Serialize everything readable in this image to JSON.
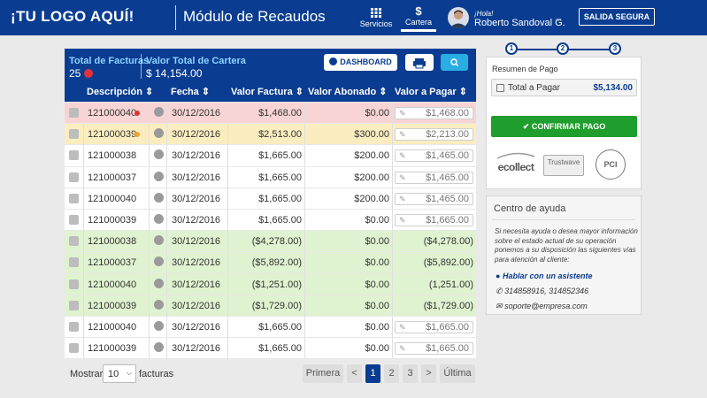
{
  "header": {
    "logo": "¡TU LOGO AQUÍ!",
    "module": "Módulo de Recaudos",
    "nav": [
      {
        "label": "Servicios",
        "icon": "grid-icon"
      },
      {
        "label": "Cartera",
        "icon": "dollar-icon"
      }
    ],
    "greeting": "¡Hola!",
    "user": "Roberto Sandoval G.",
    "logout": "SALIDA SEGURA"
  },
  "summary": {
    "facturas_label": "Total de Facturas",
    "facturas_value": "25",
    "cartera_label": "Valor Total de Cartera",
    "cartera_value": "$ 14,154.00",
    "dashboard_label": "DASHBOARD"
  },
  "columns": [
    "Descripción",
    "Fecha",
    "Valor Factura",
    "Valor Abonado",
    "Valor a Pagar"
  ],
  "rows": [
    {
      "id": "121000040",
      "status": "red",
      "date": "30/12/2016",
      "factura": "$1,468.00",
      "abonado": "$0.00",
      "pagar": "$1,468.00",
      "input": true
    },
    {
      "id": "121000039",
      "status": "yellow",
      "date": "30/12/2016",
      "factura": "$2,513.00",
      "abonado": "$300.00",
      "pagar": "$2,213.00",
      "input": true
    },
    {
      "id": "121000038",
      "status": "white",
      "date": "30/12/2016",
      "factura": "$1,665.00",
      "abonado": "$200.00",
      "pagar": "$1,465.00",
      "input": true
    },
    {
      "id": "121000037",
      "status": "white",
      "date": "30/12/2016",
      "factura": "$1,665.00",
      "abonado": "$200.00",
      "pagar": "$1,465.00",
      "input": true
    },
    {
      "id": "121000040",
      "status": "white",
      "date": "30/12/2016",
      "factura": "$1,665.00",
      "abonado": "$200.00",
      "pagar": "$1,465.00",
      "input": true
    },
    {
      "id": "121000039",
      "status": "white",
      "date": "30/12/2016",
      "factura": "$1,665.00",
      "abonado": "$0.00",
      "pagar": "$1,665.00",
      "input": true
    },
    {
      "id": "121000038",
      "status": "green",
      "date": "30/12/2016",
      "factura": "($4,278.00)",
      "abonado": "$0.00",
      "pagar": "($4,278.00)",
      "input": false
    },
    {
      "id": "121000037",
      "status": "green",
      "date": "30/12/2016",
      "factura": "($5,892.00)",
      "abonado": "$0.00",
      "pagar": "($5,892.00)",
      "input": false
    },
    {
      "id": "121000040",
      "status": "green",
      "date": "30/12/2016",
      "factura": "($1,251.00)",
      "abonado": "$0.00",
      "pagar": "(1,251.00)",
      "input": false
    },
    {
      "id": "121000039",
      "status": "green",
      "date": "30/12/2016",
      "factura": "($1,729.00)",
      "abonado": "$0.00",
      "pagar": "($1,729.00)",
      "input": false
    },
    {
      "id": "121000040",
      "status": "white",
      "date": "30/12/2016",
      "factura": "$1,665.00",
      "abonado": "$0.00",
      "pagar": "$1,665.00",
      "input": true
    },
    {
      "id": "121000039",
      "status": "white",
      "date": "30/12/2016",
      "factura": "$1,665.00",
      "abonado": "$0.00",
      "pagar": "$1,665.00",
      "input": true
    }
  ],
  "footer": {
    "show_label": "Mostrar",
    "show_value": "10",
    "show_suffix": "facturas",
    "first": "Primera",
    "prev": "<",
    "pages": [
      "1",
      "2",
      "3"
    ],
    "next": ">",
    "last": "Última"
  },
  "right": {
    "steps": [
      "1",
      "2",
      "3"
    ],
    "resumen_title": "Resumen de Pago",
    "total_label": "Total a Pagar",
    "total_value": "$5,134.00",
    "confirm_label": "CONFIRMAR PAGO",
    "seals": [
      "ecollect",
      "Trustwave",
      "PCI"
    ],
    "help_title": "Centro de ayuda",
    "help_text": "Si necesita ayuda o desea mayor información sobre el estado actual de su operación ponemos a su disposición las siguientes vías para atención al cliente:",
    "help_chat": "Hablar con un asistente",
    "help_phone": "314858916, 314852346",
    "help_email": "soporte@empresa.com"
  },
  "colors": {
    "primary": "#0a3d91",
    "accent": "#29aee3",
    "confirm": "#1f9e2d",
    "red_row": "#f8d4d4",
    "yellow_row": "#fbedbf",
    "green_row": "#dff3d0"
  }
}
